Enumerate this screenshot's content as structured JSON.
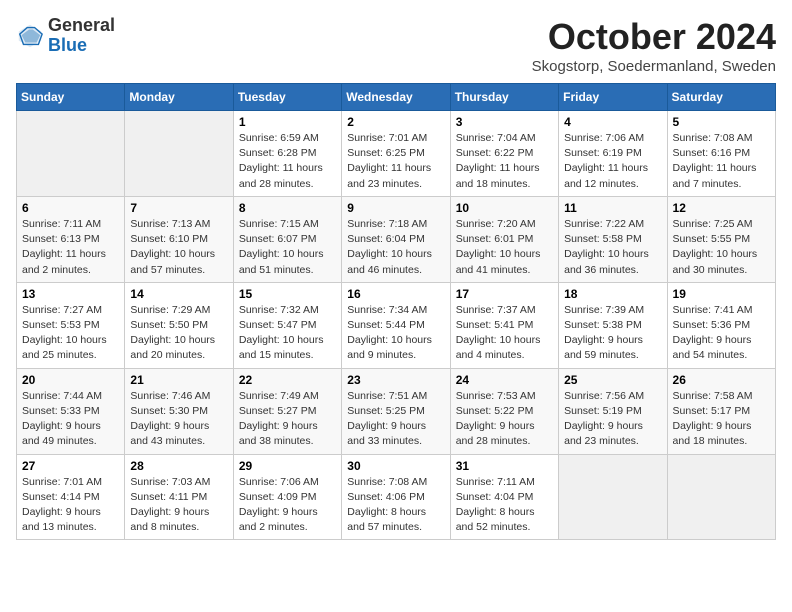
{
  "logo": {
    "general": "General",
    "blue": "Blue"
  },
  "header": {
    "title": "October 2024",
    "subtitle": "Skogstorp, Soedermanland, Sweden"
  },
  "weekdays": [
    "Sunday",
    "Monday",
    "Tuesday",
    "Wednesday",
    "Thursday",
    "Friday",
    "Saturday"
  ],
  "weeks": [
    [
      {
        "day": "",
        "info": ""
      },
      {
        "day": "",
        "info": ""
      },
      {
        "day": "1",
        "info": "Sunrise: 6:59 AM\nSunset: 6:28 PM\nDaylight: 11 hours and 28 minutes."
      },
      {
        "day": "2",
        "info": "Sunrise: 7:01 AM\nSunset: 6:25 PM\nDaylight: 11 hours and 23 minutes."
      },
      {
        "day": "3",
        "info": "Sunrise: 7:04 AM\nSunset: 6:22 PM\nDaylight: 11 hours and 18 minutes."
      },
      {
        "day": "4",
        "info": "Sunrise: 7:06 AM\nSunset: 6:19 PM\nDaylight: 11 hours and 12 minutes."
      },
      {
        "day": "5",
        "info": "Sunrise: 7:08 AM\nSunset: 6:16 PM\nDaylight: 11 hours and 7 minutes."
      }
    ],
    [
      {
        "day": "6",
        "info": "Sunrise: 7:11 AM\nSunset: 6:13 PM\nDaylight: 11 hours and 2 minutes."
      },
      {
        "day": "7",
        "info": "Sunrise: 7:13 AM\nSunset: 6:10 PM\nDaylight: 10 hours and 57 minutes."
      },
      {
        "day": "8",
        "info": "Sunrise: 7:15 AM\nSunset: 6:07 PM\nDaylight: 10 hours and 51 minutes."
      },
      {
        "day": "9",
        "info": "Sunrise: 7:18 AM\nSunset: 6:04 PM\nDaylight: 10 hours and 46 minutes."
      },
      {
        "day": "10",
        "info": "Sunrise: 7:20 AM\nSunset: 6:01 PM\nDaylight: 10 hours and 41 minutes."
      },
      {
        "day": "11",
        "info": "Sunrise: 7:22 AM\nSunset: 5:58 PM\nDaylight: 10 hours and 36 minutes."
      },
      {
        "day": "12",
        "info": "Sunrise: 7:25 AM\nSunset: 5:55 PM\nDaylight: 10 hours and 30 minutes."
      }
    ],
    [
      {
        "day": "13",
        "info": "Sunrise: 7:27 AM\nSunset: 5:53 PM\nDaylight: 10 hours and 25 minutes."
      },
      {
        "day": "14",
        "info": "Sunrise: 7:29 AM\nSunset: 5:50 PM\nDaylight: 10 hours and 20 minutes."
      },
      {
        "day": "15",
        "info": "Sunrise: 7:32 AM\nSunset: 5:47 PM\nDaylight: 10 hours and 15 minutes."
      },
      {
        "day": "16",
        "info": "Sunrise: 7:34 AM\nSunset: 5:44 PM\nDaylight: 10 hours and 9 minutes."
      },
      {
        "day": "17",
        "info": "Sunrise: 7:37 AM\nSunset: 5:41 PM\nDaylight: 10 hours and 4 minutes."
      },
      {
        "day": "18",
        "info": "Sunrise: 7:39 AM\nSunset: 5:38 PM\nDaylight: 9 hours and 59 minutes."
      },
      {
        "day": "19",
        "info": "Sunrise: 7:41 AM\nSunset: 5:36 PM\nDaylight: 9 hours and 54 minutes."
      }
    ],
    [
      {
        "day": "20",
        "info": "Sunrise: 7:44 AM\nSunset: 5:33 PM\nDaylight: 9 hours and 49 minutes."
      },
      {
        "day": "21",
        "info": "Sunrise: 7:46 AM\nSunset: 5:30 PM\nDaylight: 9 hours and 43 minutes."
      },
      {
        "day": "22",
        "info": "Sunrise: 7:49 AM\nSunset: 5:27 PM\nDaylight: 9 hours and 38 minutes."
      },
      {
        "day": "23",
        "info": "Sunrise: 7:51 AM\nSunset: 5:25 PM\nDaylight: 9 hours and 33 minutes."
      },
      {
        "day": "24",
        "info": "Sunrise: 7:53 AM\nSunset: 5:22 PM\nDaylight: 9 hours and 28 minutes."
      },
      {
        "day": "25",
        "info": "Sunrise: 7:56 AM\nSunset: 5:19 PM\nDaylight: 9 hours and 23 minutes."
      },
      {
        "day": "26",
        "info": "Sunrise: 7:58 AM\nSunset: 5:17 PM\nDaylight: 9 hours and 18 minutes."
      }
    ],
    [
      {
        "day": "27",
        "info": "Sunrise: 7:01 AM\nSunset: 4:14 PM\nDaylight: 9 hours and 13 minutes."
      },
      {
        "day": "28",
        "info": "Sunrise: 7:03 AM\nSunset: 4:11 PM\nDaylight: 9 hours and 8 minutes."
      },
      {
        "day": "29",
        "info": "Sunrise: 7:06 AM\nSunset: 4:09 PM\nDaylight: 9 hours and 2 minutes."
      },
      {
        "day": "30",
        "info": "Sunrise: 7:08 AM\nSunset: 4:06 PM\nDaylight: 8 hours and 57 minutes."
      },
      {
        "day": "31",
        "info": "Sunrise: 7:11 AM\nSunset: 4:04 PM\nDaylight: 8 hours and 52 minutes."
      },
      {
        "day": "",
        "info": ""
      },
      {
        "day": "",
        "info": ""
      }
    ]
  ]
}
